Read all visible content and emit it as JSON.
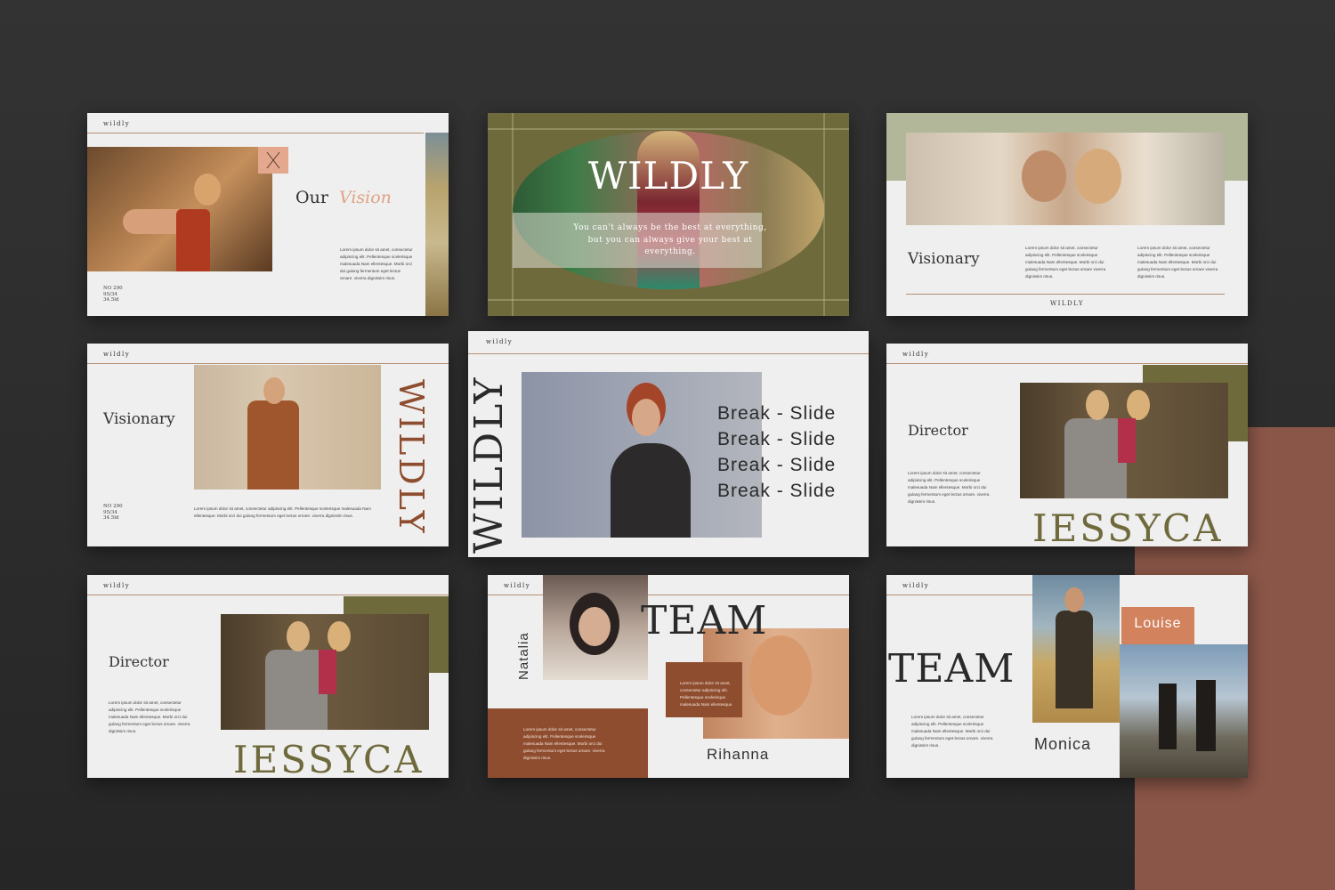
{
  "colors": {
    "background": "#2c2c2c",
    "slide": "#efefef",
    "olive": "#6f6a3c",
    "sage": "#b3b79a",
    "terracotta": "#8a5648",
    "rust": "#8f4d2f",
    "peach": "#e3a88e",
    "text_dark": "#2a2a2a"
  },
  "lorem_short": "Lorem ipsum dolor sit amet, consectetur adipiscing elit. Pellentesque scelerisque malesuada Nam ellentesque. Morbi orci dui gulang fermentum eget lectus ornare. viverra dignissim risus.",
  "slides": {
    "vision": {
      "brand": "wildly",
      "title_main": "Our",
      "title_accent": "Vision",
      "close_icon": "close-icon",
      "meta": [
        "NO 290",
        "95/34",
        "34.5ld"
      ],
      "body": "Lorem ipsum dolor sit amet, consectetur adipiscing elit. Pellentesque scelerisque malesuada Nam ellentesque. Morbi orci dui gulang fermentum eget lectus ornare. viverra dignissim risus."
    },
    "cover": {
      "title": "WILDLY",
      "quote": "You can't always be the best at everything, but you can always give your best at everything."
    },
    "visionary_top": {
      "title": "Visionary",
      "body_left": "Lorem ipsum dolor sit amet, consectetur adipiscing elit. Pellentesque scelerisque malesuada Nam ellentesque. Morbi orci dui gulang fermentum eget lectus ornare viverra dignissim risus.",
      "body_right": "Lorem ipsum dolor sit amet, consectetur adipiscing elit. Pellentesque scelerisque malesuada Nam ellentesque. Morbi orci dui gulang fermentum eget lectus ornare viverra dignissim risus.",
      "footer": "WILDLY"
    },
    "visionary_mid": {
      "brand": "wildly",
      "title": "Visionary",
      "vertical_word": "WILDLY",
      "meta": [
        "NO 290",
        "95/34",
        "34.5ld"
      ],
      "body": "Lorem ipsum dolor sit amet, consectetur adipiscing elit. Pellentesque scelerisque malesuada Nam ellentesque. Morbi orci dui gulang fermentum eget lectus ornare. viverra dignissim risus."
    },
    "break": {
      "brand": "wildly",
      "vertical_word": "WILDLY",
      "lines": [
        "Break - Slide",
        "Break - Slide",
        "Break - Slide",
        "Break - Slide"
      ]
    },
    "director_mid": {
      "brand": "wildly",
      "title": "Director",
      "name": "IESSYCA",
      "body": "Lorem ipsum dolor sit amet, consectetur adipiscing elit. Pellentesque scelerisque malesuada Nam ellentesque. Morbi orci dui gulang fermentum eget lectus ornare. viverra dignissim risus."
    },
    "director_bottom": {
      "brand": "wildly",
      "title": "Director",
      "name": "IESSYCA",
      "body": "Lorem ipsum dolor sit amet, consectetur adipiscing elit. Pellentesque scelerisque malesuada Nam ellentesque. Morbi orci dui gulang fermentum eget lectus ornare. viverra dignissim risus."
    },
    "team_mid": {
      "brand": "wildly",
      "vertical_name": "Natalia",
      "title": "TEAM",
      "name": "Rihanna",
      "body_card": "Lorem ipsum dolor sit amet, consectetur adipiscing elit. Pellentesque scelerisque malesuada Nam ellentesque.",
      "body_bottom": "Lorem ipsum dolor sit amet, consectetur adipiscing elit. Pellentesque scelerisque malesuada Nam ellentesque. Morbi orci dui gulang fermentum eget lectus ornare. viverra dignissim risus."
    },
    "team_right": {
      "brand": "wildly",
      "title": "TEAM",
      "label": "Louise",
      "name": "Monica",
      "body": "Lorem ipsum dolor sit amet, consectetur adipiscing elit. Pellentesque scelerisque malesuada Nam ellentesque. Morbi orci dui gulang fermentum eget lectus ornare. viverra dignissim risus."
    }
  }
}
